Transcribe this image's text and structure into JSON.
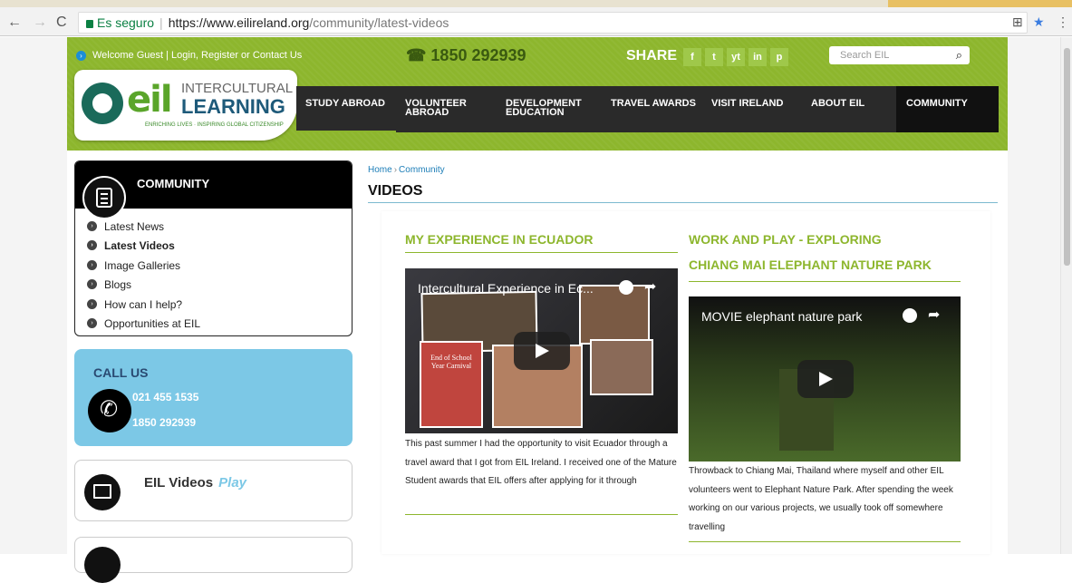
{
  "browser": {
    "secure_label": "Es seguro",
    "url_host": "https://www.eilireland.org",
    "url_path": "/community/latest-videos"
  },
  "header": {
    "welcome": "Welcome Guest | Login, Register or Contact Us",
    "phone": "1850 292939",
    "share": "SHARE",
    "social": [
      "f",
      "t",
      "yt",
      "in",
      "p"
    ],
    "search_placeholder": "Search EIL"
  },
  "logo": {
    "eil": "eil",
    "intercultural": "INTERCULTURAL",
    "learning": "LEARNING",
    "tagline": "ENRICHING LIVES · INSPIRING GLOBAL CITIZENSHIP"
  },
  "menu": {
    "study_abroad": "STUDY ABROAD",
    "volunteer_1": "VOLUNTEER",
    "volunteer_2": "ABROAD",
    "dev_1": "DEVELOPMENT",
    "dev_2": "EDUCATION",
    "travel_awards": "TRAVEL AWARDS",
    "visit_ireland": "VISIT IRELAND",
    "about": "ABOUT EIL",
    "community": "COMMUNITY"
  },
  "sidebar": {
    "title": "COMMUNITY",
    "items": [
      {
        "label": "Latest News"
      },
      {
        "label": "Latest Videos"
      },
      {
        "label": "Image Galleries"
      },
      {
        "label": "Blogs"
      },
      {
        "label": "How can I help?"
      },
      {
        "label": "Opportunities at EIL"
      }
    ],
    "call_title": "CALL US",
    "call_1": "021 455 1535",
    "call_2": "1850 292939",
    "videos_label": "EIL Videos",
    "videos_play": "Play"
  },
  "main": {
    "crumb_home": "Home",
    "crumb_community": "Community",
    "title": "VIDEOS",
    "videos": [
      {
        "heading": "MY EXPERIENCE IN ECUADOR",
        "player_title": "Intercultural Experience in Ec...",
        "poster_line_1": "End of School",
        "poster_line_2": "Year Carnival",
        "desc": "This past summer I had the opportunity to visit Ecuador through a travel award that I got from EIL Ireland. I received one of the Mature Student awards that EIL offers after applying for it through"
      },
      {
        "heading_1": "WORK AND PLAY - EXPLORING",
        "heading_2": "CHIANG MAI ELEPHANT NATURE PARK",
        "player_title": "MOVIE elephant nature park",
        "desc": "Throwback to Chiang Mai, Thailand where myself and other EIL volunteers went to Elephant Nature Park. After spending the week working on our various projects, we usually took off somewhere travelling"
      }
    ]
  },
  "colors": {
    "brand_green": "#8db62d",
    "call_blue": "#7cc8e6",
    "link_blue": "#1b7db7"
  }
}
